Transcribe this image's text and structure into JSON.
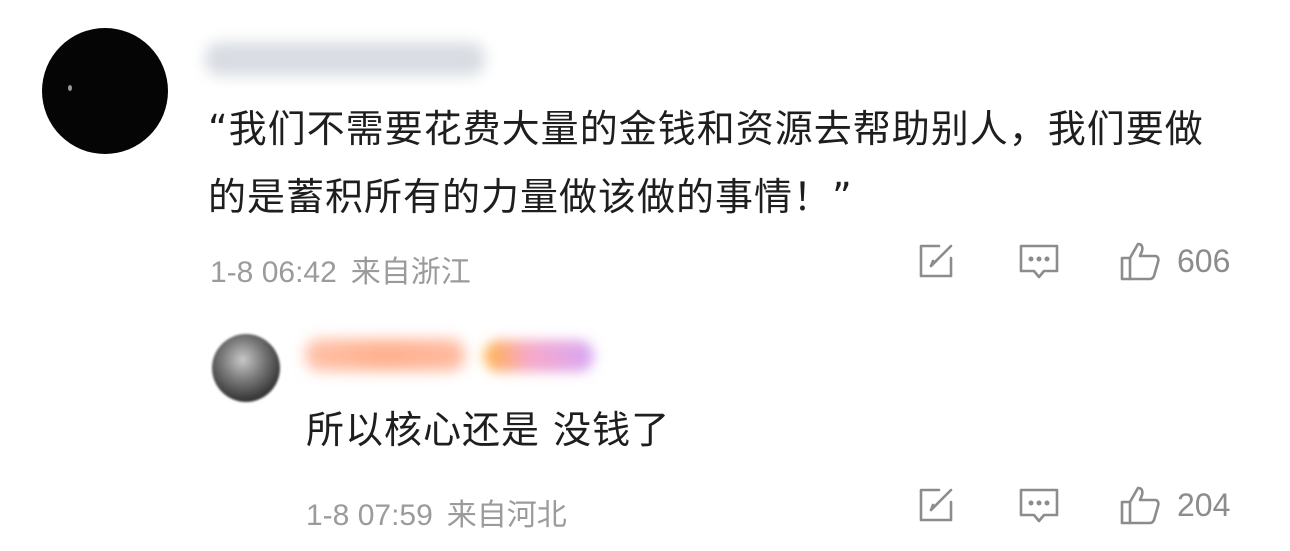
{
  "comments": [
    {
      "text": "“我们不需要花费大量的金钱和资源去帮助别人，我们要做的是蓄积所有的力量做该做的事情！”",
      "time": "1-8 06:42",
      "location": "来自浙江",
      "likes": "606"
    },
    {
      "text": "所以核心还是 没钱了",
      "time": "1-8 07:59",
      "location": "来自河北",
      "likes": "204"
    }
  ],
  "icons": {
    "repost": "repost-icon",
    "reply": "comment-icon",
    "like": "thumbs-up-icon"
  },
  "colors": {
    "text": "#1e1e1e",
    "meta": "#9b9b9b",
    "icon": "#8c8c8c"
  }
}
